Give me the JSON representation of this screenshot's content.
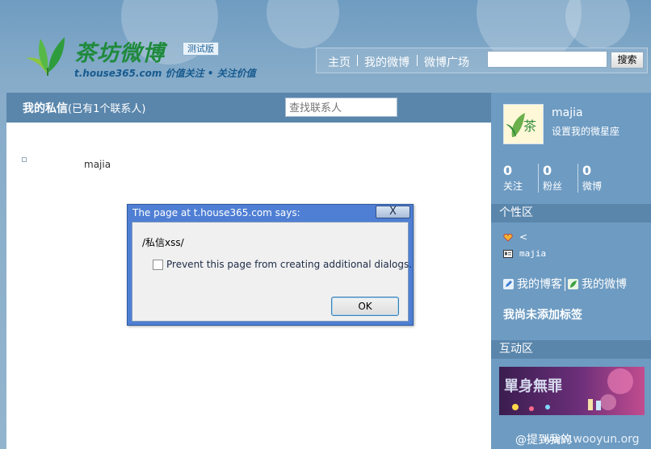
{
  "header": {
    "logo_title": "茶坊微博",
    "beta_label": "测试版",
    "domain": "t.house365.com",
    "slogan": "价值关注 • 关注价值"
  },
  "nav": {
    "home": "主页",
    "my_weibo": "我的微博",
    "square": "微博广场",
    "search_value": "",
    "search_button": "搜索"
  },
  "main": {
    "title": "我的私信",
    "contact_count": "(已有1个联系人)",
    "contact_search_placeholder": "查找联系人",
    "contacts": [
      {
        "name": "majia"
      }
    ]
  },
  "sidebar": {
    "profile": {
      "name": "majia",
      "sign_prompt": "设置我的微星座",
      "avatar_text": "茶"
    },
    "stats": [
      {
        "num": "0",
        "label": "关注"
      },
      {
        "num": "0",
        "label": "粉丝"
      },
      {
        "num": "0",
        "label": "微博"
      }
    ],
    "personal_title": "个性区",
    "personal_items": [
      {
        "text": "<",
        "icon": "heart-icon"
      },
      {
        "text": "majia",
        "icon": "id-card-icon"
      }
    ],
    "links": {
      "blog": "我的博客",
      "weibo": "我的微博"
    },
    "no_tags": "我尚未添加标签",
    "interact_title": "互动区",
    "banner_text": "單身無罪",
    "mention": "@提到我的"
  },
  "dialog": {
    "title": "The page at t.house365.com says:",
    "close_symbol": "X",
    "message": "/私信xss/",
    "checkbox_label": "Prevent this page from creating additional dialogs.",
    "ok_label": "OK"
  },
  "watermark": "www.wooyun.org",
  "colors": {
    "brand_green": "#1f8a3c",
    "header_blue": "#5a86ac",
    "sidebar_blue": "#6d9bc2",
    "dialog_blue": "#4f7fd4"
  }
}
